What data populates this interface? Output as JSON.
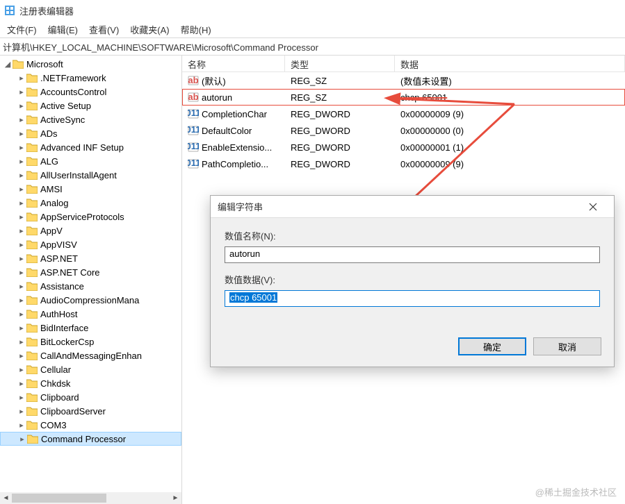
{
  "title": "注册表编辑器",
  "menu": {
    "file": "文件(F)",
    "edit": "编辑(E)",
    "view": "查看(V)",
    "favorites": "收藏夹(A)",
    "help": "帮助(H)"
  },
  "path": "计算机\\HKEY_LOCAL_MACHINE\\SOFTWARE\\Microsoft\\Command Processor",
  "tree": {
    "root": "Microsoft",
    "children": [
      ".NETFramework",
      "AccountsControl",
      "Active Setup",
      "ActiveSync",
      "ADs",
      "Advanced INF Setup",
      "ALG",
      "AllUserInstallAgent",
      "AMSI",
      "Analog",
      "AppServiceProtocols",
      "AppV",
      "AppVISV",
      "ASP.NET",
      "ASP.NET Core",
      "Assistance",
      "AudioCompressionMana",
      "AuthHost",
      "BidInterface",
      "BitLockerCsp",
      "CallAndMessagingEnhan",
      "Cellular",
      "Chkdsk",
      "Clipboard",
      "ClipboardServer",
      "COM3",
      "Command Processor"
    ],
    "selected": "Command Processor"
  },
  "columns": {
    "name": "名称",
    "type": "类型",
    "data": "数据"
  },
  "rows": [
    {
      "icon": "sz",
      "name": "(默认)",
      "type": "REG_SZ",
      "data": "(数值未设置)"
    },
    {
      "icon": "sz",
      "name": "autorun",
      "type": "REG_SZ",
      "data": "chcp 65001",
      "highlight": true,
      "strike": true
    },
    {
      "icon": "dw",
      "name": "CompletionChar",
      "type": "REG_DWORD",
      "data": "0x00000009 (9)"
    },
    {
      "icon": "dw",
      "name": "DefaultColor",
      "type": "REG_DWORD",
      "data": "0x00000000 (0)"
    },
    {
      "icon": "dw",
      "name": "EnableExtensio...",
      "type": "REG_DWORD",
      "data": "0x00000001 (1)"
    },
    {
      "icon": "dw",
      "name": "PathCompletio...",
      "type": "REG_DWORD",
      "data": "0x00000009 (9)"
    }
  ],
  "dialog": {
    "title": "编辑字符串",
    "name_label": "数值名称(N):",
    "name_value": "autorun",
    "data_label": "数值数据(V):",
    "data_value": "chcp 65001",
    "ok": "确定",
    "cancel": "取消"
  },
  "watermark": "@稀土掘金技术社区"
}
